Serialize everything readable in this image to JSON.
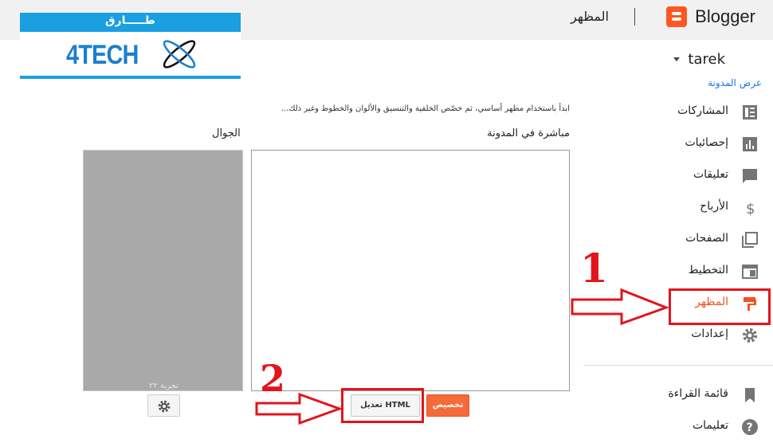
{
  "app": {
    "brand_name": "Blogger",
    "page_heading": "المظهر"
  },
  "watermark": {
    "top_text": "طـــــارق",
    "logo_text": "4TECH"
  },
  "sidebar": {
    "blog_name": "tarek",
    "view_blog": "عرض المدونة",
    "items": [
      {
        "label": "المشاركات",
        "icon": "posts-icon"
      },
      {
        "label": "إحصائيات",
        "icon": "stats-icon"
      },
      {
        "label": "تعليقات",
        "icon": "comments-icon"
      },
      {
        "label": "الأرباح",
        "icon": "earnings-icon"
      },
      {
        "label": "الصفحات",
        "icon": "pages-icon"
      },
      {
        "label": "التخطيط",
        "icon": "layout-icon"
      },
      {
        "label": "المظهر",
        "icon": "theme-icon"
      },
      {
        "label": "إعدادات",
        "icon": "settings-icon"
      }
    ],
    "secondary_items": [
      {
        "label": "قائمة القراءة",
        "icon": "reading-list-icon"
      },
      {
        "label": "تعليمات",
        "icon": "help-icon"
      }
    ]
  },
  "main": {
    "intro": "ابدأ باستخدام مظهر أساسي، ثم خصّص الخلفية والتنسيق والألوان والخطوط وغير ذلك...",
    "live_title": "مباشرة في المدونة",
    "mobile_title": "الجوال",
    "mobile_caption": "تجربة ٢٢",
    "edit_html_label": "تعديل HTML",
    "customize_label": "تخصيص"
  },
  "annotations": {
    "marker_1": "1",
    "marker_2": "2"
  },
  "colors": {
    "accent": "#f4511e",
    "annotation": "#e3141c",
    "watermark_blue": "#1a9fe0"
  }
}
